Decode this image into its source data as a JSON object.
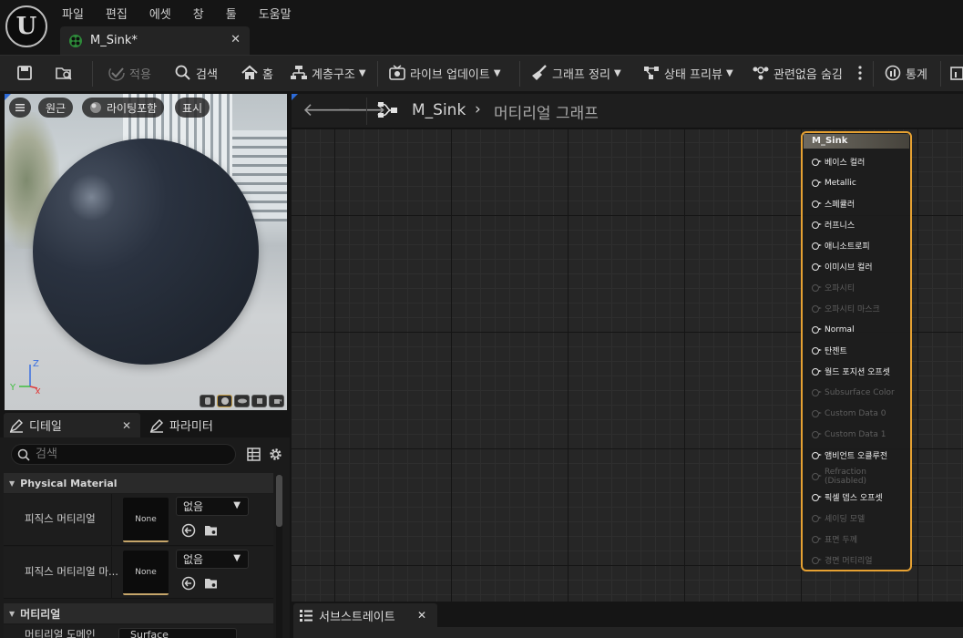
{
  "menu": [
    "파일",
    "편집",
    "에셋",
    "창",
    "툴",
    "도움말"
  ],
  "document_tab": {
    "label": "M_Sink*",
    "close": "✕"
  },
  "toolbar": {
    "apply": "적용",
    "search": "검색",
    "home": "홈",
    "hierarchy": "계층구조",
    "live_update": "라이브 업데이트",
    "clean_graph": "그래프 정리",
    "stats_preview": "상태 프리뷰",
    "hide_unrelated": "관련없음 숨김",
    "stats": "통계"
  },
  "viewport": {
    "perspective": "원근",
    "lighting": "라이팅포함",
    "show": "표시",
    "axis_z": "Z",
    "axis_y": "Y",
    "axis_x": "X"
  },
  "details": {
    "tab_details": "디테일",
    "tab_parameters": "파라미터",
    "search_placeholder": "검색",
    "category_physical": "Physical Material",
    "prop1_label": "피직스 머티리얼",
    "prop2_label": "피직스 머티리얼 마...",
    "thumb_none": "None",
    "combo_none": "없음",
    "category_material": "머티리얼",
    "prop3_label": "머티리얼 도메인",
    "prop3_value": "Surface"
  },
  "graph": {
    "breadcrumb_asset": "M_Sink",
    "breadcrumb_graph": "머티리얼 그래프"
  },
  "node": {
    "title": "M_Sink",
    "pins": [
      {
        "label": "베이스 컬러",
        "enabled": true
      },
      {
        "label": "Metallic",
        "enabled": true
      },
      {
        "label": "스페큘러",
        "enabled": true
      },
      {
        "label": "러프니스",
        "enabled": true
      },
      {
        "label": "애니소트로피",
        "enabled": true
      },
      {
        "label": "이미시브 컬러",
        "enabled": true
      },
      {
        "label": "오파시티",
        "enabled": false
      },
      {
        "label": "오파시티 마스크",
        "enabled": false
      },
      {
        "label": "Normal",
        "enabled": true
      },
      {
        "label": "탄젠트",
        "enabled": true
      },
      {
        "label": "월드 포지션 오프셋",
        "enabled": true
      },
      {
        "label": "Subsurface Color",
        "enabled": false
      },
      {
        "label": "Custom Data 0",
        "enabled": false
      },
      {
        "label": "Custom Data 1",
        "enabled": false
      },
      {
        "label": "앰비언트 오클루전",
        "enabled": true
      },
      {
        "label": "Refraction (Disabled)",
        "enabled": false
      },
      {
        "label": "픽셀 뎁스 오프셋",
        "enabled": true
      },
      {
        "label": "셰이딩 모델",
        "enabled": false
      },
      {
        "label": "표면 두께",
        "enabled": false
      },
      {
        "label": "경면 머티리얼",
        "enabled": false
      }
    ]
  },
  "bottom_tab": {
    "label": "서브스트레이트",
    "close": "✕"
  },
  "colors": {
    "accent_orange": "#e6a132",
    "accent_blue": "#2d6bd8",
    "thumb_underline": "#c6a66a"
  }
}
